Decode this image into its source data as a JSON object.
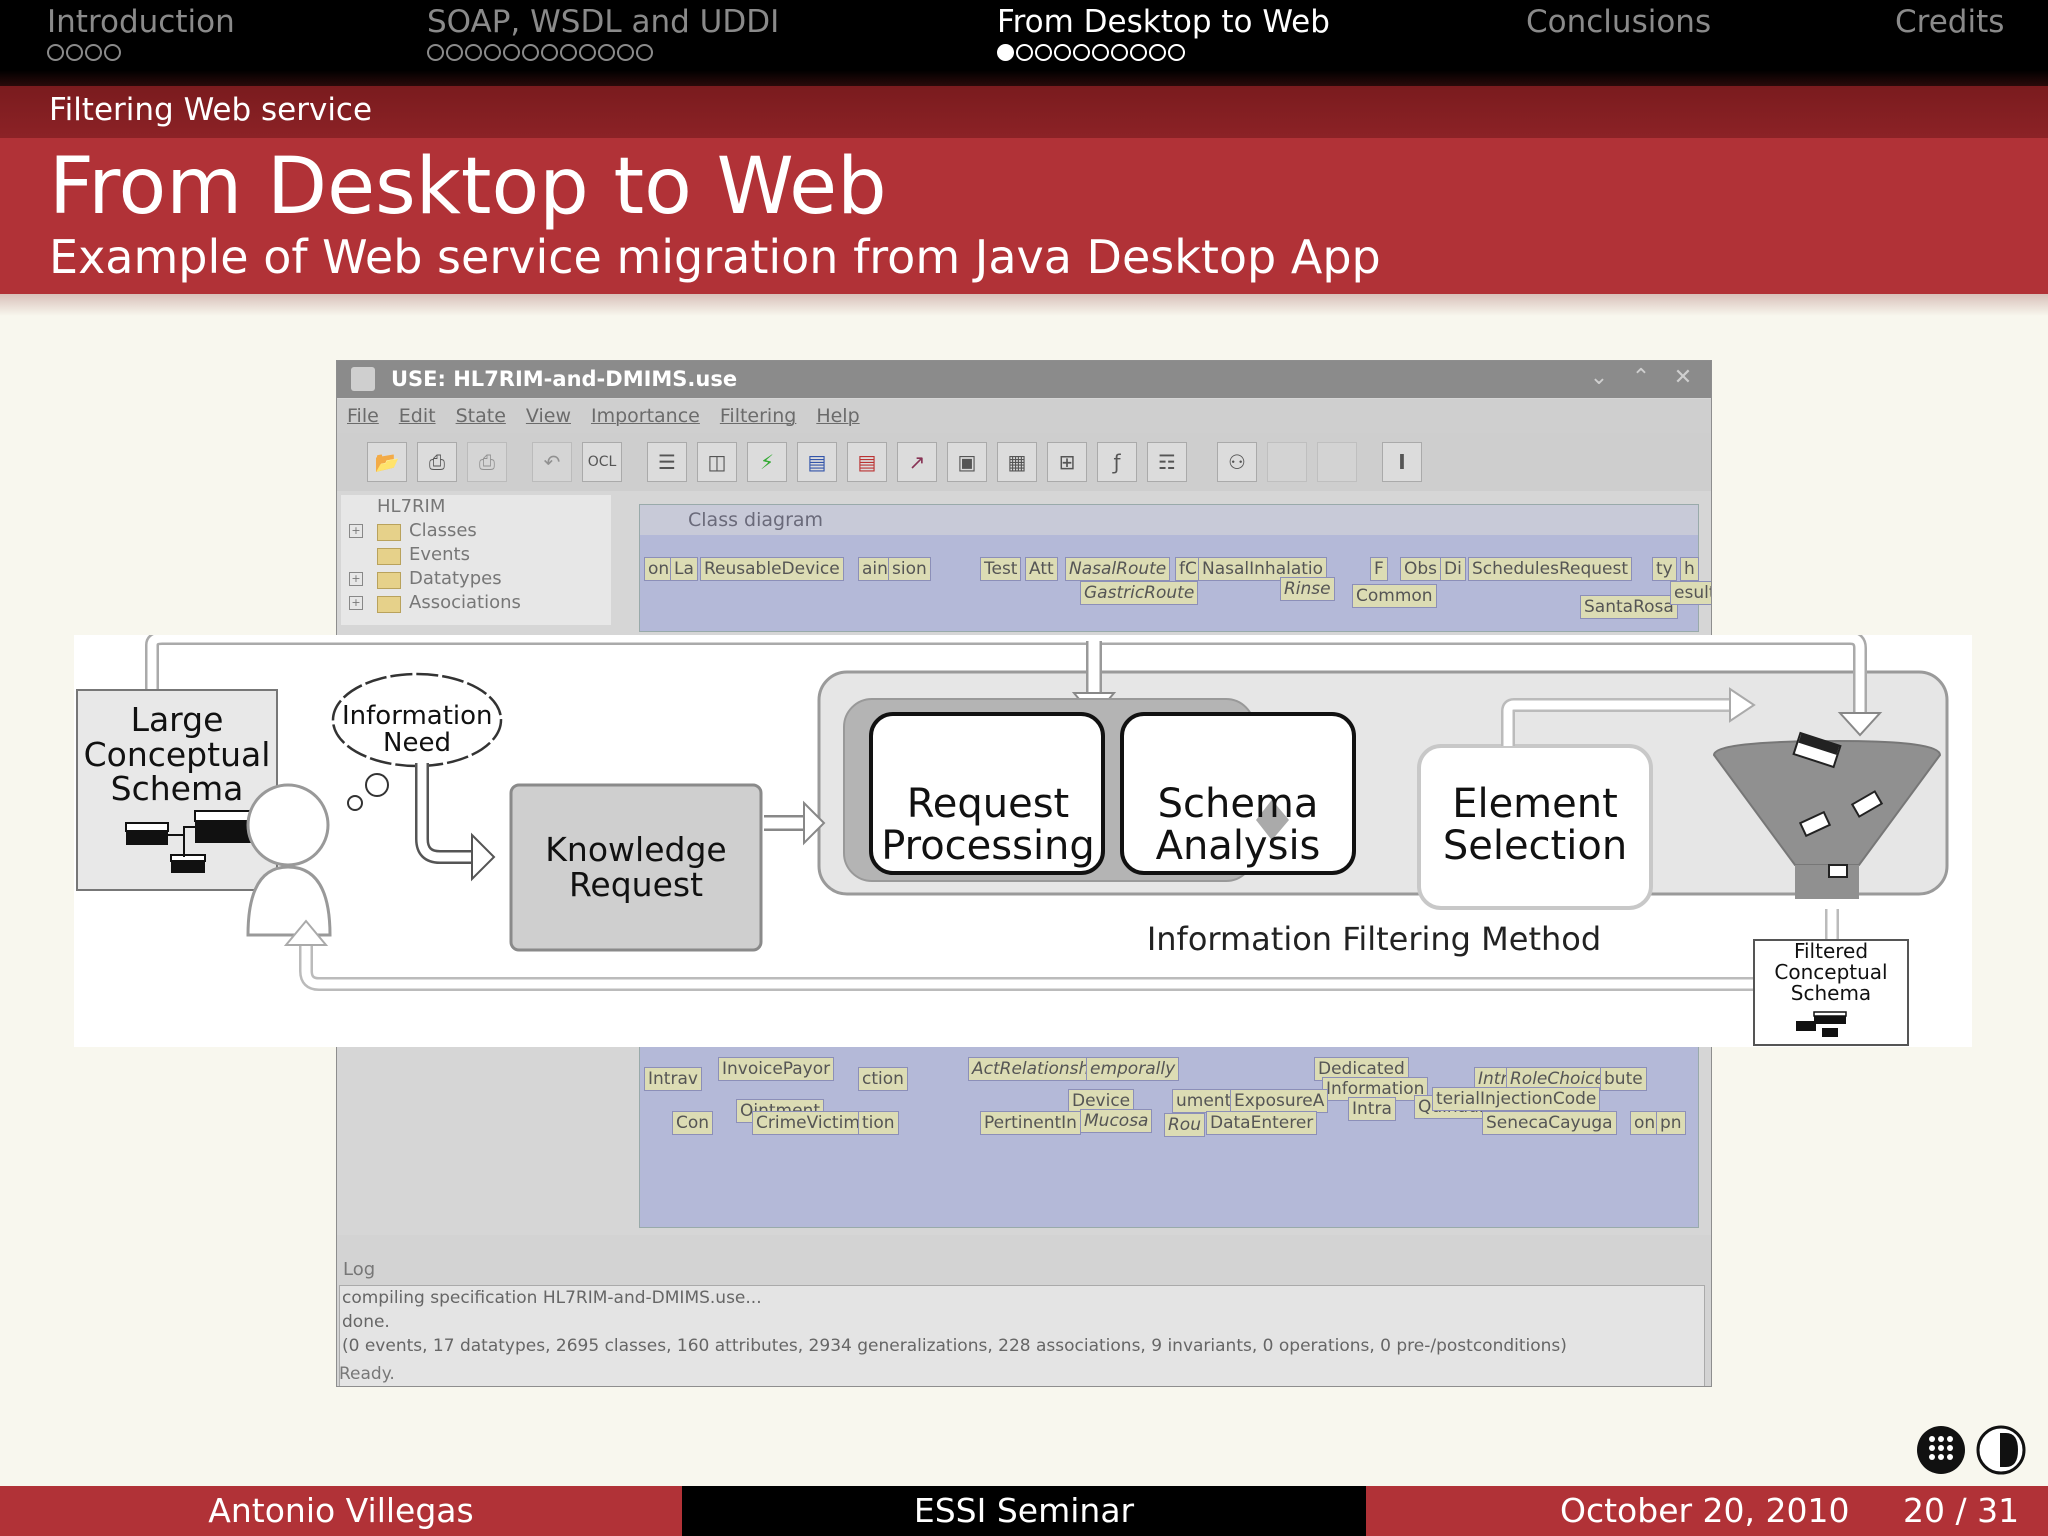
{
  "nav": {
    "sections": [
      {
        "label": "Introduction",
        "dots": 4,
        "filled": 0,
        "active": false
      },
      {
        "label": "SOAP, WSDL and UDDI",
        "dots": 12,
        "filled": 0,
        "active": false
      },
      {
        "label": "From Desktop to Web",
        "dots": 10,
        "filled": 1,
        "active": true
      },
      {
        "label": "Conclusions",
        "dots": 0,
        "filled": 0,
        "active": false
      },
      {
        "label": "Credits",
        "dots": 0,
        "filled": 0,
        "active": false
      }
    ]
  },
  "subsection": "Filtering Web service",
  "frame": {
    "title": "From Desktop to Web",
    "subtitle": "Example of Web service migration from Java Desktop App"
  },
  "app": {
    "window_title": "USE: HL7RIM-and-DMIMS.use",
    "menu": [
      "File",
      "Edit",
      "State",
      "View",
      "Importance",
      "Filtering",
      "Help"
    ],
    "toolbar_ocl": "OCL",
    "tree": {
      "root": "HL7RIM",
      "items": [
        "Classes",
        "Events",
        "Datatypes",
        "Associations"
      ]
    },
    "diagram_title": "Class diagram",
    "classes_top": [
      "on",
      "La",
      "ReusableDevice",
      "ain",
      "sion",
      "Test",
      "Att",
      "NasalRoute",
      "fC",
      "NasalInhalatio",
      "F",
      "Obs",
      "Di",
      "SchedulesRequest",
      "ty",
      "h",
      "GastricRoute",
      "Rinse",
      "Common",
      "SantaRosa",
      "esult"
    ],
    "classes_bottom": [
      "InvoicePayor",
      "ction",
      "ActRelationshipPosting",
      "emporally",
      "Dedicated",
      "Intr",
      "RoleChoice",
      "bute",
      "Intrav",
      "Information",
      "Device",
      "umentati",
      "ExposureA",
      "Intra",
      "Quinault",
      "terialInjectionCode",
      "Ointment",
      "Con",
      "CrimeVictim",
      "tion",
      "PertinentIn",
      "Mucosa",
      "Rou",
      "DataEnterer",
      "SenecaCayuga",
      "on",
      "pn"
    ],
    "log_label": "Log",
    "log_lines": [
      "compiling specification HL7RIM-and-DMIMS.use...",
      "done.",
      "(0 events, 17 datatypes, 2695 classes, 160 attributes, 2934 generalizations, 228 associations, 9 invariants, 0 operations, 0 pre-/postconditions)"
    ],
    "status": "Ready."
  },
  "overlay": {
    "large_schema": "Large Conceptual Schema",
    "information_need": "Information Need",
    "knowledge_request": "Knowledge Request",
    "request_processing": "Request Processing",
    "schema_analysis": "Schema Analysis",
    "element_selection": "Element Selection",
    "method_label": "Information Filtering Method",
    "filtered_schema": "Filtered Conceptual Schema"
  },
  "footer": {
    "author": "Antonio Villegas",
    "event": "ESSI Seminar",
    "date": "October 20, 2010",
    "page": "20 / 31"
  },
  "colors": {
    "accent_red": "#b13237",
    "dark_red": "#7a1b1e",
    "nav_bg": "#000000"
  }
}
